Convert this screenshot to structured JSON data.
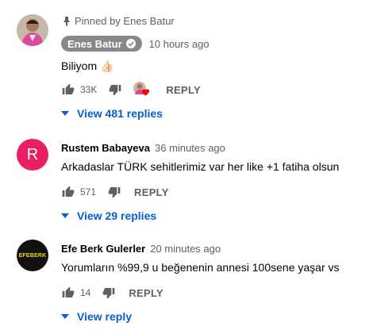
{
  "comments": [
    {
      "pinned_label": "Pinned by Enes Batur",
      "author": "Enes Batur",
      "verified": true,
      "time": "10 hours ago",
      "text": "Biliyom 👍🏻",
      "likes": "33K",
      "reply_label": "REPLY",
      "view_replies": "View 481 replies",
      "creator_heart": true
    },
    {
      "author": "Rustem Babayeva",
      "avatar_letter": "R",
      "avatar_color": "#e91e63",
      "time": "36 minutes ago",
      "text": "Arkadaslar TÜRK sehitlerimiz var her like +1 fatiha olsun",
      "likes": "571",
      "reply_label": "REPLY",
      "view_replies": "View 29 replies"
    },
    {
      "author": "Efe Berk Gulerler",
      "avatar_text": "EFEBERK",
      "avatar_color": "#111111",
      "avatar_text_color": "#f5d40f",
      "time": "20 minutes ago",
      "text": "Yorumların %99,9 u beğenenin annesi 100sene yaşar vs",
      "likes": "14",
      "reply_label": "REPLY",
      "view_replies": "View reply"
    }
  ],
  "colors": {
    "link": "#065fd4",
    "secondary": "#606060",
    "heart": "#ff0000"
  }
}
